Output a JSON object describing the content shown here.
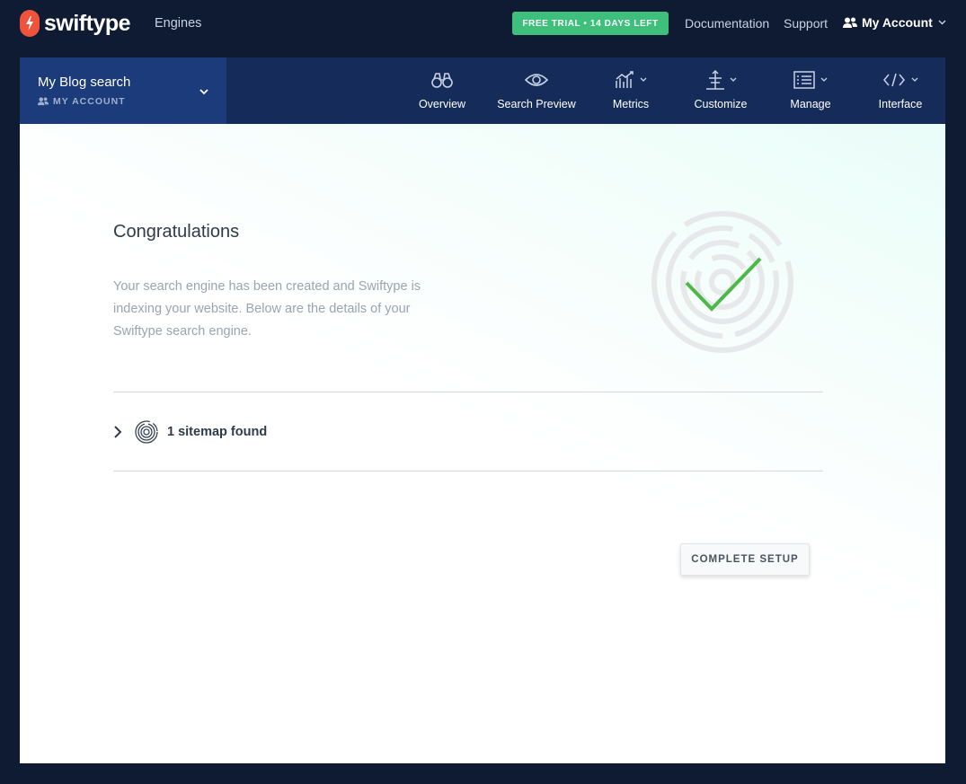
{
  "brand": {
    "name": "swiftype",
    "color": "#f0533b"
  },
  "topnav": {
    "engines": "Engines",
    "trial_badge": "FREE TRIAL • 14 DAYS LEFT",
    "documentation": "Documentation",
    "support": "Support",
    "account": "My Account"
  },
  "engine": {
    "name": "My Blog search",
    "account": "MY ACCOUNT"
  },
  "tabs": [
    {
      "label": "Overview",
      "icon": "binoculars-icon",
      "dropdown": false
    },
    {
      "label": "Search Preview",
      "icon": "eye-icon",
      "dropdown": false
    },
    {
      "label": "Metrics",
      "icon": "chart-icon",
      "dropdown": true
    },
    {
      "label": "Customize",
      "icon": "sliders-icon",
      "dropdown": true
    },
    {
      "label": "Manage",
      "icon": "list-icon",
      "dropdown": true
    },
    {
      "label": "Interface",
      "icon": "code-icon",
      "dropdown": true
    }
  ],
  "main": {
    "title": "Congratulations",
    "description": "Your search engine has been created and Swiftype is indexing your website. Below are the details of your Swiftype search engine.",
    "sitemap_label": "1 sitemap found",
    "complete_button": "COMPLETE SETUP"
  },
  "colors": {
    "accent_green": "#3ec07c",
    "check_green": "#4cb848",
    "navy": "#0f1b33"
  }
}
